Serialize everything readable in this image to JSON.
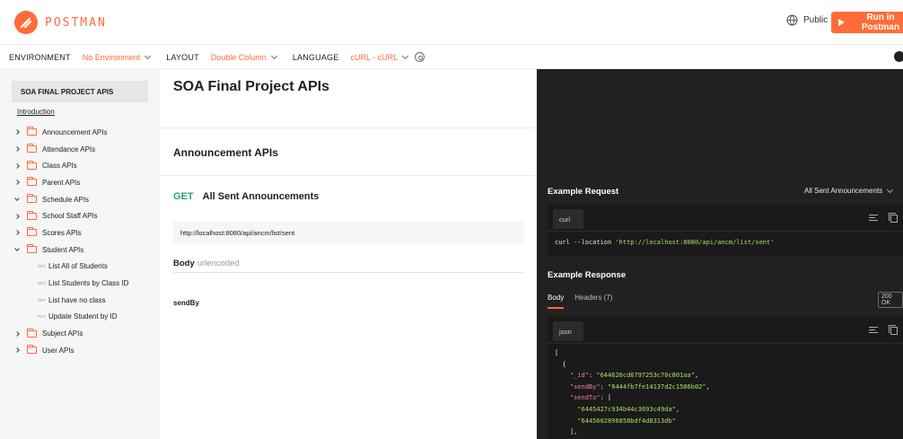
{
  "brand": {
    "name": "POSTMAN",
    "accent": "#ff6c37"
  },
  "header": {
    "visibility": "Public",
    "run_button": "Run in Postman"
  },
  "options": {
    "environment_label": "ENVIRONMENT",
    "environment_value": "No Environment",
    "layout_label": "LAYOUT",
    "layout_value": "Double Column",
    "language_label": "LANGUAGE",
    "language_value": "cURL - cURL"
  },
  "sidebar": {
    "collection": "SOA FINAL PROJECT APIS",
    "introduction": "Introduction",
    "folders": [
      {
        "label": "Announcement APIs",
        "expanded": false
      },
      {
        "label": "Attendance APIs",
        "expanded": false
      },
      {
        "label": "Class APIs",
        "expanded": false
      },
      {
        "label": "Parent APIs",
        "expanded": false
      },
      {
        "label": "Schedule APIs",
        "expanded": true
      },
      {
        "label": "School Staff APIs",
        "expanded": false
      },
      {
        "label": "Scores APIs",
        "expanded": false
      },
      {
        "label": "Student APIs",
        "expanded": true
      }
    ],
    "student_requests": [
      {
        "method": "GET",
        "label": "List All of Students"
      },
      {
        "method": "GET",
        "label": "List Students by Class ID"
      },
      {
        "method": "GET",
        "label": "List have no class"
      },
      {
        "method": "PUT",
        "label": "Update Student by ID"
      }
    ],
    "folders_after": [
      {
        "label": "Subject APIs"
      },
      {
        "label": "User APIs"
      }
    ]
  },
  "main": {
    "title": "SOA Final Project APIs",
    "section": "Announcement APIs",
    "request": {
      "method": "GET",
      "name": "All Sent Announcements",
      "url": "http://localhost:8080/api/ancm/list/sent",
      "body_label": "Body",
      "body_type": "urlencoded",
      "field": "sendBy"
    }
  },
  "example": {
    "request_title": "Example Request",
    "request_select": "All Sent Announcements",
    "request_lang": "curl",
    "curl_prefix": "curl --location ",
    "curl_url": "'http://localhost:8080/api/ancm/list/sent'",
    "response_title": "Example Response",
    "tabs": [
      "Body",
      "Headers (7)"
    ],
    "status": "200 OK",
    "response_lang": "json",
    "json": {
      "open_bracket": "[",
      "open_brace": "{",
      "id_key": "\"_id\"",
      "id_val": "\"644620cd6797253c70c801aa\"",
      "sendby_key": "\"sendBy\"",
      "sendby_val": "\"6444fb7fe14137d2c1586b02\"",
      "sendto_key": "\"sendTo\"",
      "sendto_1": "\"6445427c934b44c3693c49da\"",
      "sendto_2": "\"6445602896858bdf4d8313db\"",
      "close_arr": "],"
    }
  }
}
